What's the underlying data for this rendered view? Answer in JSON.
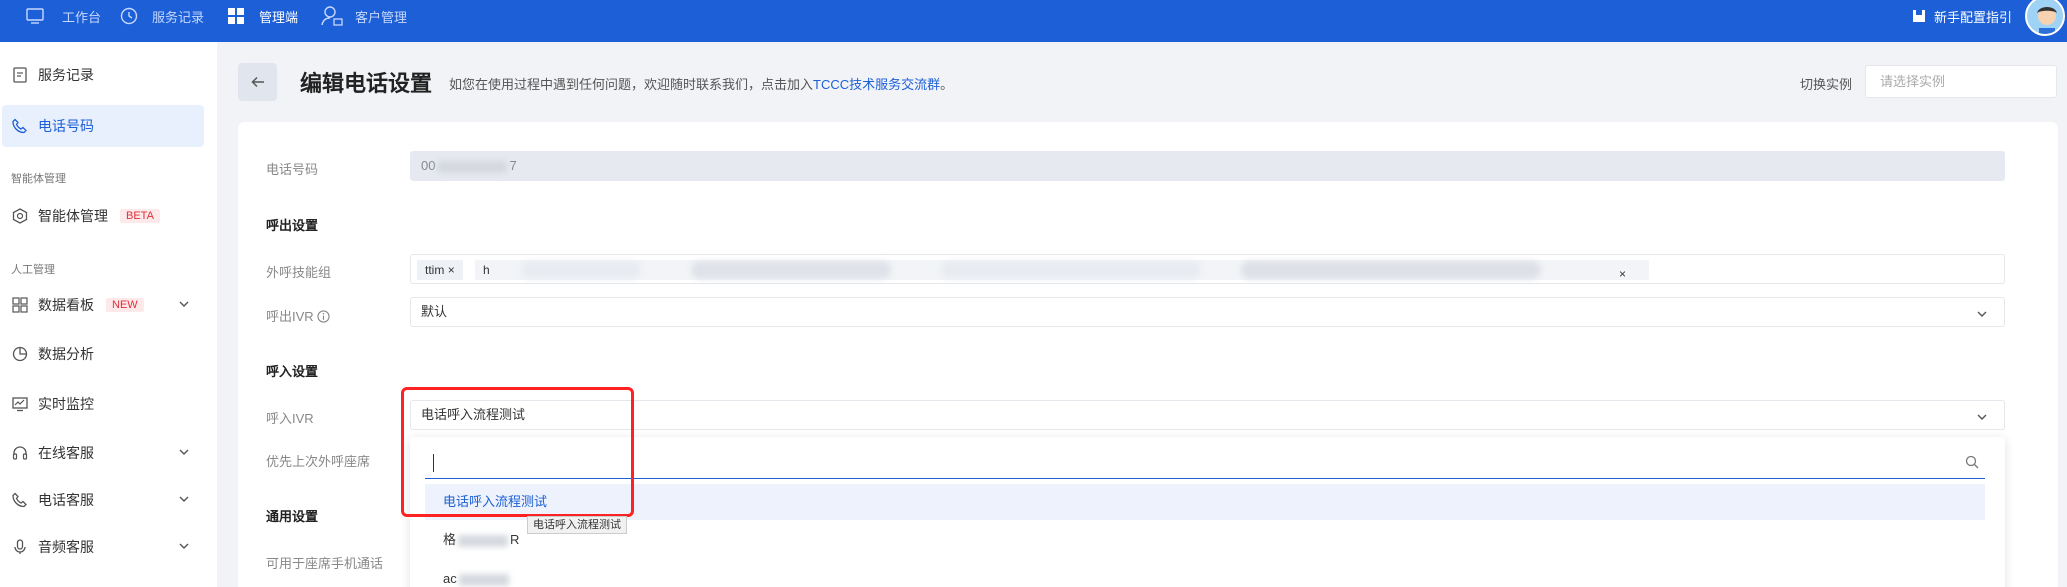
{
  "topbar": {
    "nav": [
      {
        "label": "工作台",
        "icon": "monitor-icon"
      },
      {
        "label": "服务记录",
        "icon": "clock-icon"
      },
      {
        "label": "管理端",
        "icon": "grid-icon"
      },
      {
        "label": "客户管理",
        "icon": "customer-icon"
      }
    ],
    "guide_label": "新手配置指引"
  },
  "sidebar": {
    "items_top": [
      {
        "label": "服务记录",
        "icon": "document-icon"
      },
      {
        "label": "电话号码",
        "icon": "phone-icon"
      }
    ],
    "group_agent": "智能体管理",
    "agent_item": {
      "label": "智能体管理",
      "badge": "BETA"
    },
    "group_manual": "人工管理",
    "items_manual": [
      {
        "label": "数据看板",
        "badge": "NEW",
        "icon": "dashboard-icon"
      },
      {
        "label": "数据分析",
        "icon": "pie-chart-icon"
      },
      {
        "label": "实时监控",
        "icon": "monitor-chart-icon"
      },
      {
        "label": "在线客服",
        "icon": "headset-icon"
      },
      {
        "label": "电话客服",
        "icon": "phone-icon"
      },
      {
        "label": "音频客服",
        "icon": "microphone-icon"
      }
    ]
  },
  "header": {
    "title": "编辑电话设置",
    "hint_prefix": "如您在使用过程中遇到任何问题，欢迎随时联系我们，点击加入",
    "hint_link": "TCCC技术服务交流群",
    "hint_suffix": "。",
    "switch_label": "切换实例",
    "switch_placeholder": "请选择实例"
  },
  "form": {
    "phone_label": "电话号码",
    "phone_value_prefix": "00",
    "phone_value_suffix": "7",
    "outbound_section": "呼出设置",
    "skill_group_label": "外呼技能组",
    "skill_tags": [
      "ttim",
      "h"
    ],
    "outbound_ivr_label": "呼出IVR",
    "outbound_ivr_value": "默认",
    "inbound_section": "呼入设置",
    "inbound_ivr_label": "呼入IVR",
    "inbound_ivr_value": "电话呼入流程测试",
    "priority_label": "优先上次外呼座席",
    "general_section": "通用设置",
    "mobile_label": "可用于座席手机通话"
  },
  "dropdown": {
    "search_value": "",
    "options": [
      "电话呼入流程测试",
      "格",
      "ac"
    ],
    "option2_suffix": "R",
    "tooltip": "电话呼入流程测试"
  },
  "colors": {
    "brand": "#1d5fd6",
    "highlight": "#ff2222"
  }
}
